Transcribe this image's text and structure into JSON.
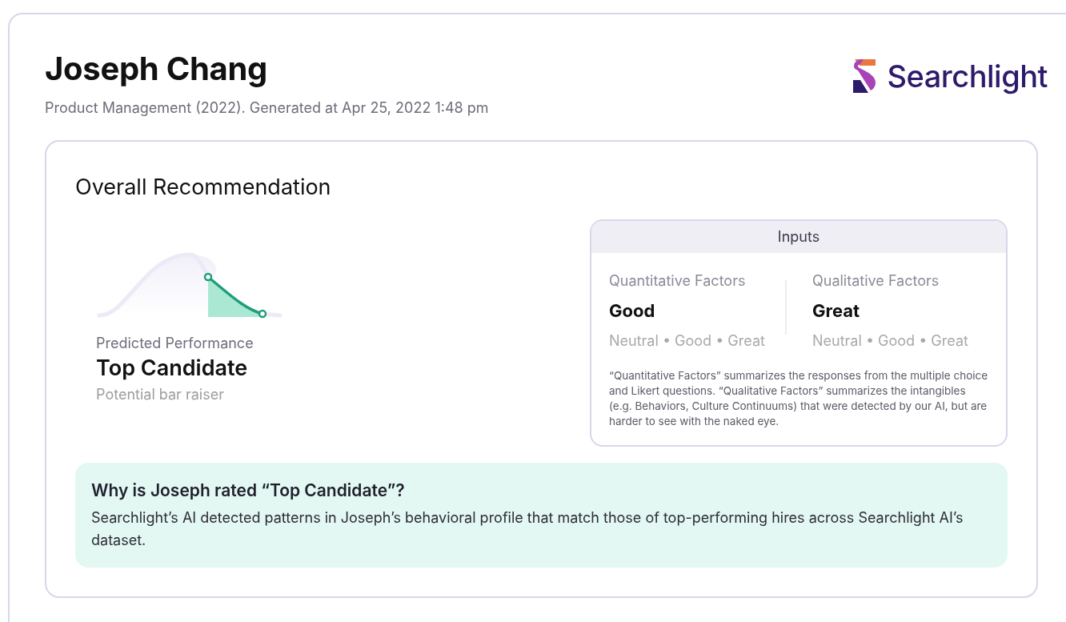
{
  "header": {
    "name": "Joseph Chang",
    "subtitle": "Product Management (2022). Generated at Apr 25, 2022 1:48 pm",
    "logo_text": "Searchlight"
  },
  "recommendation": {
    "title": "Overall Recommendation",
    "label": "Predicted Performance",
    "result": "Top Candidate",
    "note": "Potential bar raiser",
    "inputs": {
      "title": "Inputs",
      "factors": [
        {
          "label": "Quantitative Factors",
          "value": "Good",
          "scale": "Neutral • Good • Great"
        },
        {
          "label": "Qualitative Factors",
          "value": "Great",
          "scale": "Neutral • Good • Great"
        }
      ],
      "description": "“Quantitative Factors” summarizes the responses from the multiple choice and Likert questions. “Qualitative Factors” summarizes the intangibles (e.g. Behaviors, Culture Continuums) that were detected by our AI, but are harder to see with the naked eye."
    },
    "why": {
      "title": "Why is Joseph rated “Top Candidate”?",
      "text": "Searchlight’s AI detected patterns in Joseph’s behavioral profile that match those of top-performing hires across Searchlight AI’s dataset."
    }
  }
}
